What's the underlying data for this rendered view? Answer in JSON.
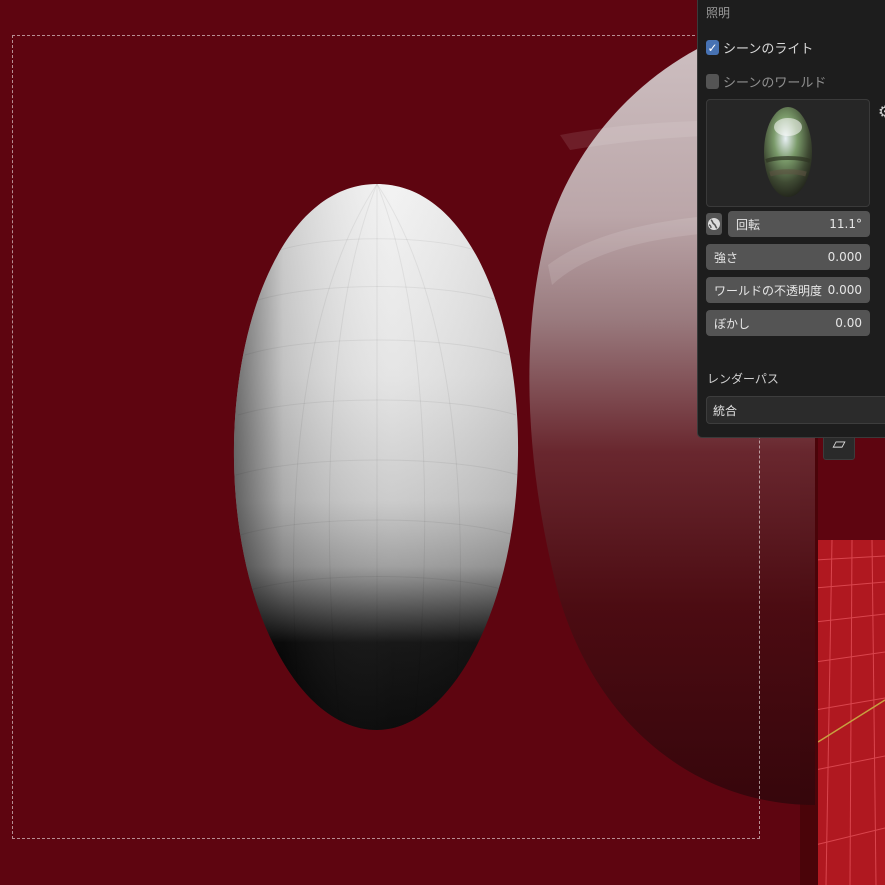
{
  "viewport": {
    "background_color": "#5e0510",
    "floor_color": "#b01820"
  },
  "panel": {
    "title": "照明",
    "scene_lights": {
      "label": "シーンのライト",
      "checked": true
    },
    "scene_world": {
      "label": "シーンのワールド",
      "checked": false
    },
    "hdri_preview_icon": "hdri-sphere-preview",
    "settings_icon": "gear-icon",
    "world_space_icon": "globe-icon",
    "fields": [
      {
        "label": "回転",
        "value": "11.1°"
      },
      {
        "label": "強さ",
        "value": "0.000"
      },
      {
        "label": "ワールドの不透明度",
        "value": "0.000"
      },
      {
        "label": "ぼかし",
        "value": "0.00"
      }
    ],
    "render_pass": {
      "label": "レンダーパス",
      "value": "統合"
    }
  },
  "accent_color": "#4772b3"
}
